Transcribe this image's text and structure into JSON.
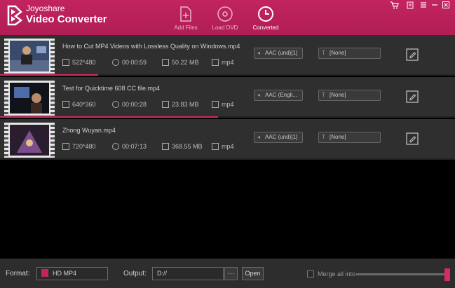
{
  "app": {
    "brand_top": "Joyoshare",
    "brand_bottom": "Video Converter",
    "accent": "#c2245e"
  },
  "nav": [
    {
      "label": "Add Files",
      "icon": "add-file-icon",
      "active": false
    },
    {
      "label": "Load DVD",
      "icon": "dvd-icon",
      "active": false
    },
    {
      "label": "Converted",
      "icon": "clock-icon",
      "active": true
    }
  ],
  "files": [
    {
      "name": "How to Cut MP4 Videos with Lossless Quality on Windows.mp4",
      "resolution": "522*480",
      "duration": "00:00:59",
      "size": "50.22 MB",
      "format": "mp4",
      "audio": "AAC (und)[1]",
      "subtitle": "[None]",
      "progress": 0.22
    },
    {
      "name": "Test for Quicktime 608 CC file.mp4",
      "resolution": "640*360",
      "duration": "00:00:28",
      "size": "23.83 MB",
      "format": "mp4",
      "audio": "AAC (Engli...",
      "subtitle": "[None]",
      "progress": 0.48
    },
    {
      "name": "Zhong Wuyan.mp4",
      "resolution": "720*480",
      "duration": "00:07:13",
      "size": "368.55 MB",
      "format": "mp4",
      "audio": "AAC (und)[1]",
      "subtitle": "[None]",
      "progress": 0
    }
  ],
  "footer": {
    "format_label": "Format:",
    "format_value": "HD MP4",
    "output_label": "Output:",
    "output_value": "D://",
    "browse_label": "···",
    "open_label": "Open",
    "merge_label": "Merge all into"
  }
}
